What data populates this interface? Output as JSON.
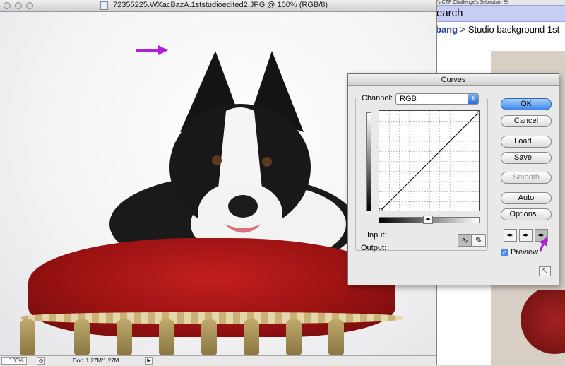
{
  "document": {
    "title": "72355225.WXacBazA.1ststudioedited2.JPG @ 100% (RGB/8)",
    "zoom": "100%",
    "doc_size": "Doc: 1.27M/1.27M"
  },
  "browser": {
    "tab_strip": "e's  CTF Challenge's  Sebastian  Bl",
    "search_label": "earch",
    "breadcrumb_link": "bang",
    "breadcrumb_rest": " > Studio background 1st"
  },
  "curves": {
    "title": "Curves",
    "channel_label": "Channel:",
    "channel_value": "RGB",
    "input_label": "Input:",
    "output_label": "Output:",
    "buttons": {
      "ok": "OK",
      "cancel": "Cancel",
      "load": "Load...",
      "save": "Save...",
      "smooth": "Smooth",
      "auto": "Auto",
      "options": "Options..."
    },
    "preview_label": "Preview",
    "preview_checked": true
  },
  "annotations": {
    "arrow_color": "#b01fd8"
  },
  "icons": {
    "doc": "document-icon",
    "curve_tool": "curve-tool-icon",
    "pencil_tool": "pencil-tool-icon",
    "black_point": "black-eyedropper-icon",
    "gray_point": "gray-eyedropper-icon",
    "white_point": "white-eyedropper-icon"
  }
}
